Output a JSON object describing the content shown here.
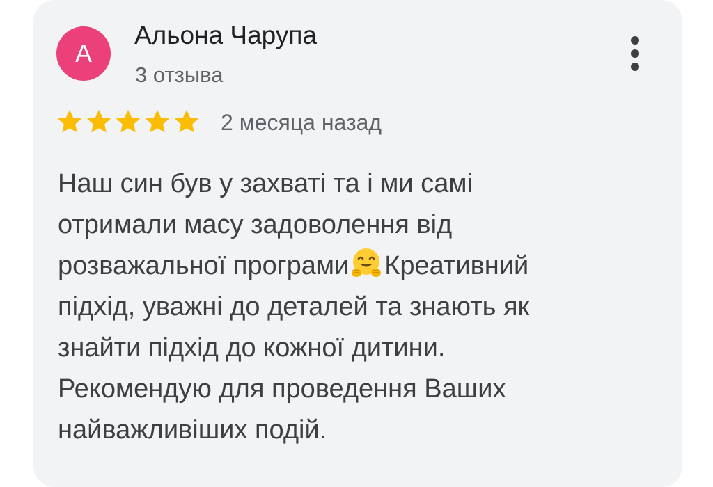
{
  "reviewer": {
    "avatar_letter": "А",
    "name": "Альона Чарупа",
    "reviews_count": "3 отзыва",
    "avatar_color": "#ec407a"
  },
  "rating": {
    "stars": 5,
    "max": 5,
    "star_color": "#fbbc04"
  },
  "review_date": "2 месяца назад",
  "menu_icon": "more-vert-icon",
  "review_text": {
    "line1": "Наш син був у захваті та і ми самі",
    "line2": "отримали масу задоволення від",
    "line3_before": "розважальної програми",
    "line3_emoji": "hugging-face-emoji",
    "line3_after": "Креативний",
    "line4": "підхід, уважні до деталей та знають як",
    "line5": "знайти підхід до кожної дитини.",
    "line6": "Рекомендую для проведення Ваших",
    "line7": "найважливіших подій."
  }
}
